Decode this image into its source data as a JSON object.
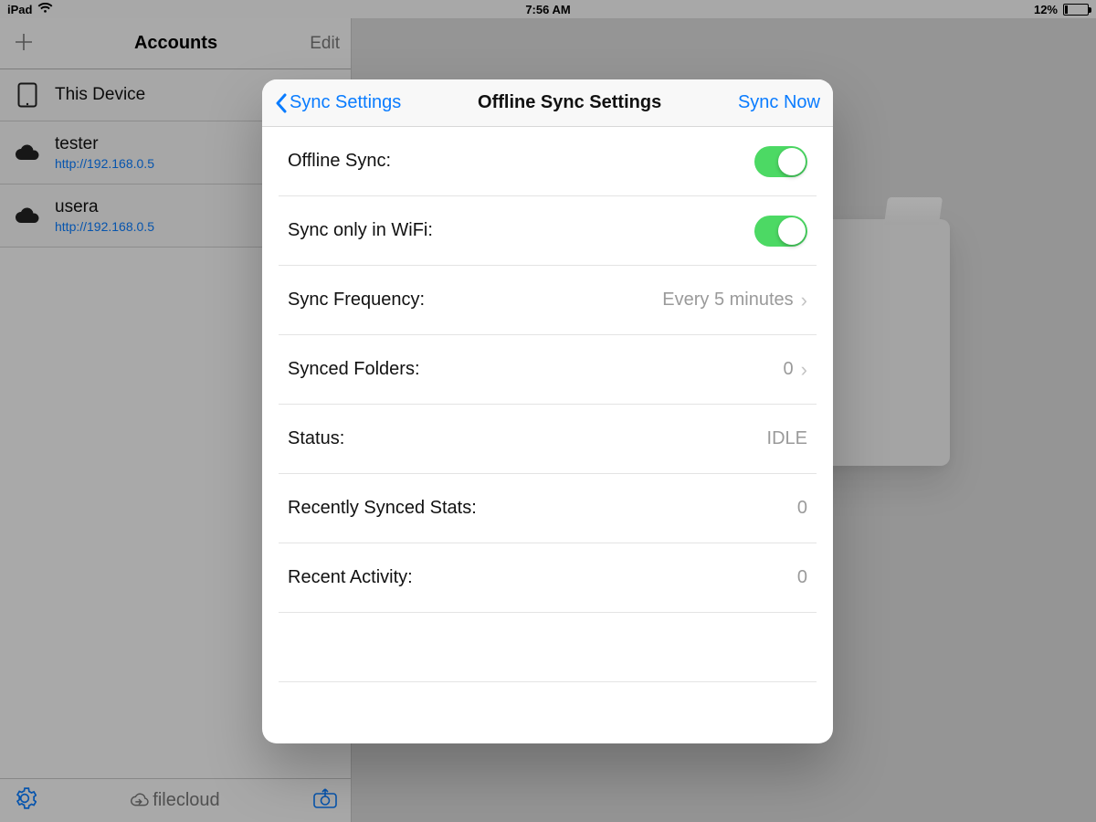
{
  "statusbar": {
    "device": "iPad",
    "time": "7:56 AM",
    "battery_pct": "12%"
  },
  "sidebar": {
    "title": "Accounts",
    "edit_label": "Edit",
    "items": [
      {
        "name": "This Device",
        "url": ""
      },
      {
        "name": "tester",
        "url": "http://192.168.0.5"
      },
      {
        "name": "usera",
        "url": "http://192.168.0.5"
      }
    ],
    "brand": "filecloud"
  },
  "modal": {
    "back_label": "Sync Settings",
    "title": "Offline Sync Settings",
    "action_label": "Sync Now",
    "rows": {
      "offline_sync": {
        "label": "Offline Sync:",
        "on": true
      },
      "wifi_only": {
        "label": "Sync only in WiFi:",
        "on": true
      },
      "frequency": {
        "label": "Sync Frequency:",
        "value": "Every 5 minutes"
      },
      "synced_folders": {
        "label": "Synced Folders:",
        "value": "0"
      },
      "status": {
        "label": "Status:",
        "value": "IDLE"
      },
      "recent_stats": {
        "label": "Recently Synced Stats:",
        "value": "0"
      },
      "recent_activity": {
        "label": "Recent Activity:",
        "value": "0"
      }
    }
  }
}
